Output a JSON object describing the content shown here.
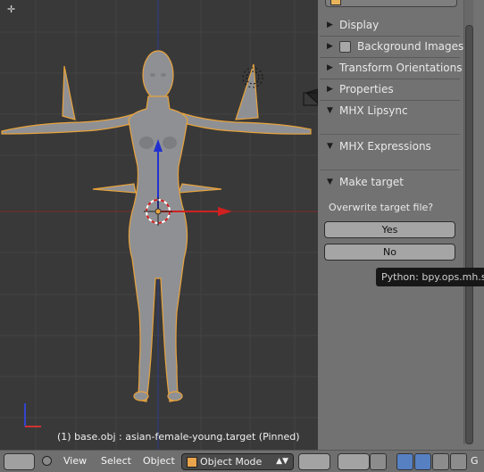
{
  "viewport": {
    "status_text": "(1) base.obj : asian-female-young.target  (Pinned)",
    "plus_glyph": "✛"
  },
  "npanel": {
    "panels": [
      {
        "label": "Display",
        "expanded": false
      },
      {
        "label": "Background Images",
        "expanded": false,
        "checkbox": true
      },
      {
        "label": "Transform Orientations",
        "expanded": false
      },
      {
        "label": "Properties",
        "expanded": false
      },
      {
        "label": "MHX Lipsync",
        "expanded": true
      },
      {
        "label": "MHX Expressions",
        "expanded": true
      },
      {
        "label": "Make target",
        "expanded": true
      }
    ],
    "make_target": {
      "question": "Overwrite target file?",
      "yes_label": "Yes",
      "no_label": "No"
    },
    "tooltip": "Python: bpy.ops.mh.skip"
  },
  "header": {
    "menus": {
      "view": "View",
      "select": "Select",
      "object": "Object"
    },
    "mode": "Object Mode",
    "last_letter": "G"
  },
  "colors": {
    "selection_outline": "#e8a33c",
    "axis_red": "#d02020",
    "axis_blue": "#2030d0",
    "mesh": "#8f9094"
  }
}
